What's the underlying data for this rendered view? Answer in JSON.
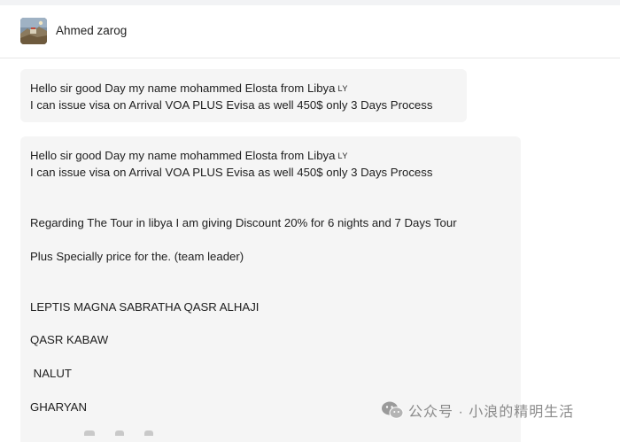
{
  "header": {
    "contact_name": "Ahmed zarog"
  },
  "messages": [
    {
      "lines": [
        {
          "text": "Hello sir good Day my name mohammed Elosta from Libya",
          "flag": "LY"
        },
        {
          "text": "I can issue visa on Arrival VOA PLUS Evisa as well 450$ only 3 Days Process"
        }
      ]
    },
    {
      "lines": [
        {
          "text": "Hello sir good Day my name mohammed Elosta from Libya",
          "flag": "LY"
        },
        {
          "text": "I can issue visa on Arrival VOA PLUS Evisa as well 450$ only 3 Days Process"
        },
        {
          "text": "Regarding The Tour in libya I am giving Discount 20% for 6 nights and 7 Days Tour"
        },
        {
          "text": "Plus Specially price for the. (team leader)"
        },
        {
          "text": "LEPTIS MAGNA SABRATHA QASR ALHAJI"
        },
        {
          "text": "QASR KABAW"
        },
        {
          "text": " NALUT"
        },
        {
          "text": "GHARYAN"
        }
      ]
    }
  ],
  "watermark": {
    "text": "公众号 · 小浪的精明生活",
    "icon": "wechat-official-account-icon"
  },
  "icons": {
    "avatar": "contact-avatar-image"
  },
  "colors": {
    "bubble_background": "#f5f5f5",
    "page_background": "#ffffff",
    "text": "#202020",
    "watermark": "#8a8a8a"
  }
}
